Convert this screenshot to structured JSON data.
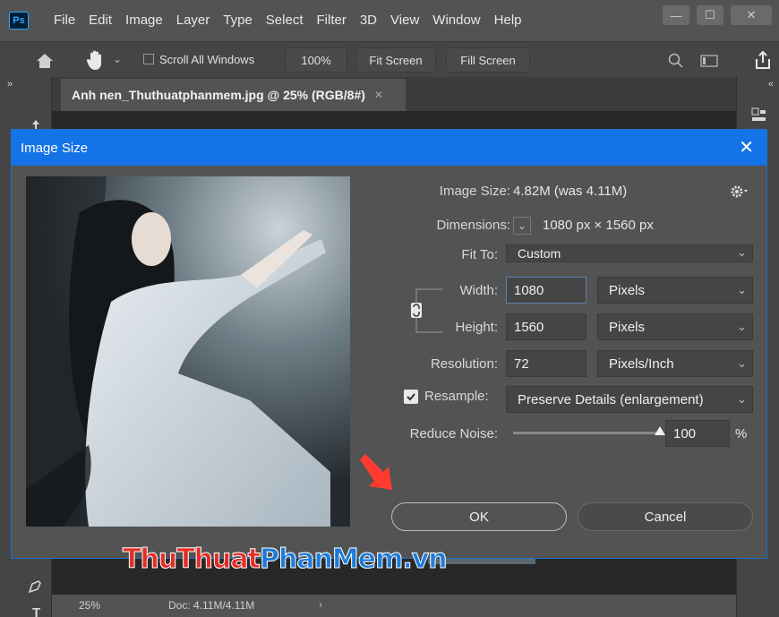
{
  "app": {
    "logo": "Ps"
  },
  "menu": [
    "File",
    "Edit",
    "Image",
    "Layer",
    "Type",
    "Select",
    "Filter",
    "3D",
    "View",
    "Window",
    "Help"
  ],
  "options_bar": {
    "scroll_all_label": "Scroll All Windows",
    "zoom_button": "100%",
    "fit_screen": "Fit Screen",
    "fill_screen": "Fill Screen"
  },
  "document_tab": {
    "title": "Anh nen_Thuthuatphanmem.jpg @ 25% (RGB/8#)"
  },
  "status": {
    "zoom": "25%",
    "doc": "Doc: 4.11M/4.11M"
  },
  "dialog": {
    "title": "Image Size",
    "image_size_label": "Image Size:",
    "image_size_value": "4.82M (was 4.11M)",
    "dimensions_label": "Dimensions:",
    "dimensions_value": "1080 px × 1560 px",
    "fit_to_label": "Fit To:",
    "fit_to_value": "Custom",
    "width_label": "Width:",
    "width_value": "1080",
    "width_unit": "Pixels",
    "height_label": "Height:",
    "height_value": "1560",
    "height_unit": "Pixels",
    "resolution_label": "Resolution:",
    "resolution_value": "72",
    "resolution_unit": "Pixels/Inch",
    "resample_label": "Resample:",
    "resample_checked": true,
    "resample_value": "Preserve Details (enlargement)",
    "reduce_noise_label": "Reduce Noise:",
    "reduce_noise_value": "100",
    "reduce_noise_unit": "%",
    "ok": "OK",
    "cancel": "Cancel"
  },
  "watermark": {
    "part1": "Thu",
    "part2": "Thuat",
    "part3": "PhanMem",
    "part4": ".vn"
  },
  "colors": {
    "accent": "#1473e6",
    "arrow": "#ff3b30"
  }
}
